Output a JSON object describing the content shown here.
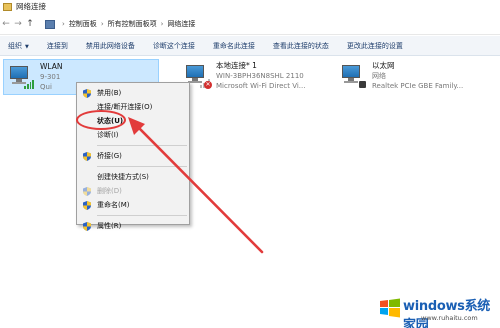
{
  "window": {
    "title": "网络连接"
  },
  "address": {
    "back": "←",
    "forward": "→",
    "up": "↑",
    "crumbs": [
      "控制面板",
      "所有控制面板项",
      "网络连接"
    ],
    "separator": "›"
  },
  "commands": [
    "组织",
    "连接到",
    "禁用此网络设备",
    "诊断这个连接",
    "重命名此连接",
    "查看此连接的状态",
    "更改此连接的设置"
  ],
  "adapters": [
    {
      "name": "WLAN",
      "line1": "9-301",
      "line2": "Qui",
      "selected": true,
      "kind": "wifi"
    },
    {
      "name": "本地连接* 1",
      "line1": "WIN-3BPH36N8SHL 2110",
      "line2": "Microsoft Wi-Fi Direct Vi...",
      "selected": false,
      "kind": "wifi-off"
    },
    {
      "name": "以太网",
      "line1": "网络",
      "line2": "Realtek PCIe GBE Family...",
      "selected": false,
      "kind": "ethernet"
    }
  ],
  "context_menu": [
    {
      "label": "禁用(B)",
      "shield": true,
      "bold": false,
      "disabled": false
    },
    {
      "label": "连接/断开连接(O)",
      "shield": false,
      "bold": false,
      "disabled": false
    },
    {
      "label": "状态(U)",
      "shield": false,
      "bold": true,
      "disabled": false
    },
    {
      "label": "诊断(I)",
      "shield": false,
      "bold": false,
      "disabled": false
    },
    {
      "separator": true
    },
    {
      "label": "桥接(G)",
      "shield": true,
      "bold": false,
      "disabled": false
    },
    {
      "separator": true
    },
    {
      "label": "创建快捷方式(S)",
      "shield": false,
      "bold": false,
      "disabled": false
    },
    {
      "label": "删除(D)",
      "shield": true,
      "bold": false,
      "disabled": true
    },
    {
      "label": "重命名(M)",
      "shield": true,
      "bold": false,
      "disabled": false
    },
    {
      "separator": true
    },
    {
      "label": "属性(R)",
      "shield": true,
      "bold": false,
      "disabled": false
    }
  ],
  "watermark": {
    "brand": "windows系统家园",
    "url": "www.ruhaitu.com"
  },
  "colors": {
    "selection": "#cce8ff",
    "annotation": "#e23b3b",
    "brand": "#1a5fb4"
  }
}
